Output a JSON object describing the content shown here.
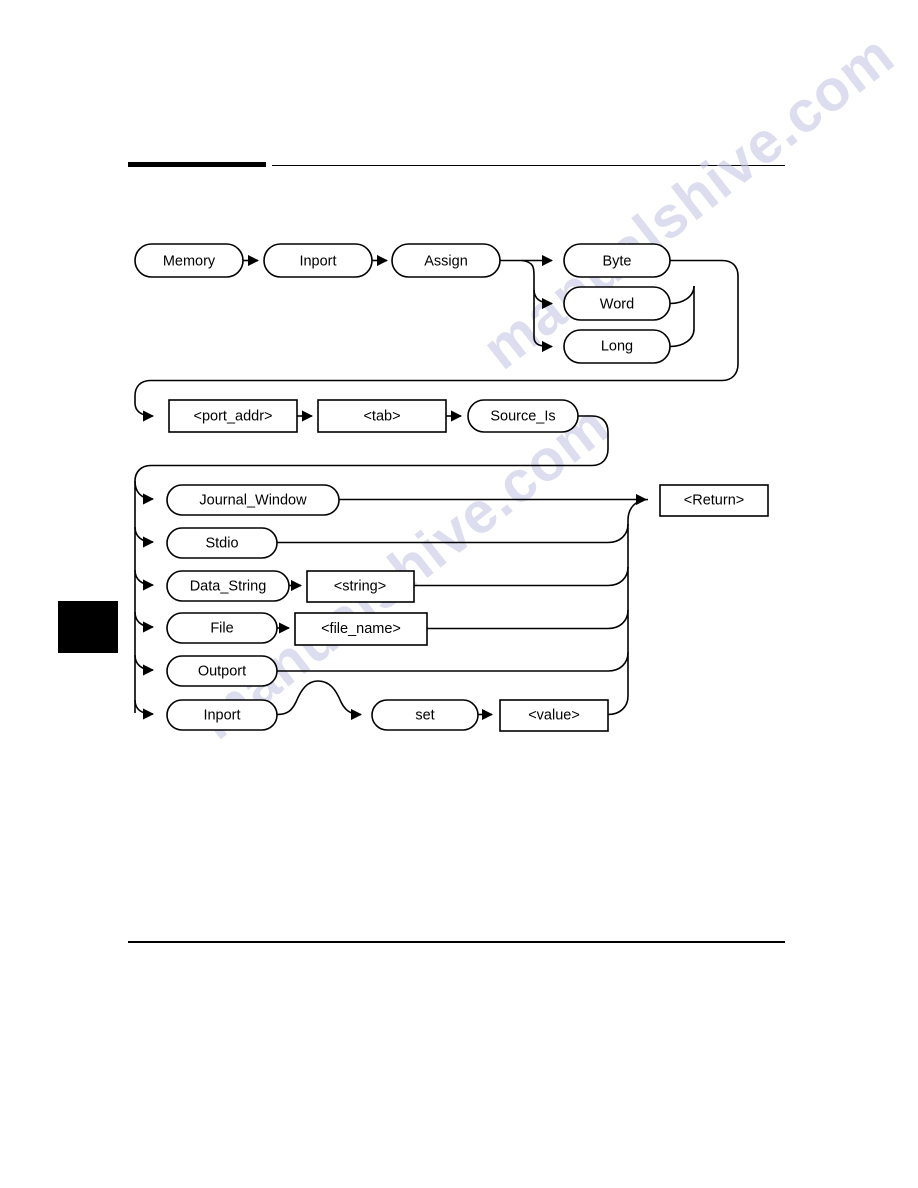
{
  "page": {
    "background_color": "#ffffff",
    "ink_color": "#000000",
    "watermark_color": "#c9c9e8",
    "watermark_line_1": "manualshive.com",
    "watermark_line_2": "manualshive.com"
  },
  "header": {
    "thick_rule": true,
    "thin_rule": true
  },
  "footer": {
    "thin_rule": true
  },
  "tab_marker": {
    "label": "black-edge-tab"
  },
  "diagram": {
    "title": "Memory Inport Assign syntax diagram",
    "type": "railroad-syntax-diagram",
    "rows": [
      {
        "row": 1,
        "nodes": [
          {
            "id": "memory",
            "label": "Memory",
            "shape": "stadium"
          },
          {
            "id": "inport",
            "label": "Inport",
            "shape": "stadium"
          },
          {
            "id": "assign",
            "label": "Assign",
            "shape": "stadium"
          },
          {
            "id": "byte",
            "label": "Byte",
            "shape": "stadium"
          },
          {
            "id": "word",
            "label": "Word",
            "shape": "stadium"
          },
          {
            "id": "long",
            "label": "Long",
            "shape": "stadium"
          }
        ]
      },
      {
        "row": 2,
        "nodes": [
          {
            "id": "port_addr",
            "label": "<port_addr>",
            "shape": "rect"
          },
          {
            "id": "tab",
            "label": "<tab>",
            "shape": "rect"
          },
          {
            "id": "source_is",
            "label": "Source_Is",
            "shape": "stadium"
          }
        ]
      },
      {
        "row": 3,
        "nodes": [
          {
            "id": "journal_window",
            "label": "Journal_Window",
            "shape": "stadium"
          },
          {
            "id": "stdio",
            "label": "Stdio",
            "shape": "stadium"
          },
          {
            "id": "data_string",
            "label": "Data_String",
            "shape": "stadium"
          },
          {
            "id": "string",
            "label": "<string>",
            "shape": "rect"
          },
          {
            "id": "file",
            "label": "File",
            "shape": "stadium"
          },
          {
            "id": "file_name",
            "label": "<file_name>",
            "shape": "rect"
          },
          {
            "id": "outport",
            "label": "Outport",
            "shape": "stadium"
          },
          {
            "id": "inport2",
            "label": "Inport",
            "shape": "stadium"
          },
          {
            "id": "set",
            "label": "set",
            "shape": "stadium"
          },
          {
            "id": "value",
            "label": "<value>",
            "shape": "rect"
          },
          {
            "id": "return",
            "label": "<Return>",
            "shape": "rect"
          }
        ]
      }
    ]
  }
}
